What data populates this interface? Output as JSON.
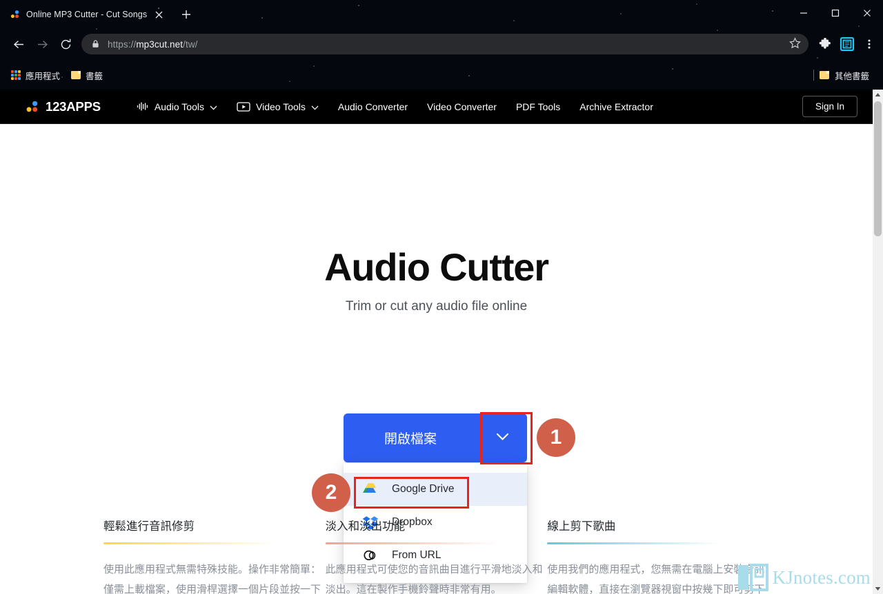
{
  "browser": {
    "tab": {
      "title": "Online MP3 Cutter - Cut Songs",
      "favicon": "123apps-dots-favicon",
      "close_icon": "close-icon",
      "newtab_icon": "plus-icon"
    },
    "window_controls": {
      "minimize": "minimize-icon",
      "maximize": "maximize-icon",
      "close": "close-icon"
    },
    "toolbar": {
      "back_icon": "arrow-left-icon",
      "forward_icon": "arrow-right-icon",
      "reload_icon": "reload-icon",
      "lock_icon": "lock-icon",
      "url_full": "https://mp3cut.net/tw/",
      "url_prefix": "https://",
      "url_host": "mp3cut.net",
      "url_path": "/tw/",
      "bookmark_star_icon": "star-icon",
      "extension_icon": "puzzle-piece-icon",
      "kjnotes_extension_icon": "kjnotes-extension-icon",
      "menu_icon": "three-dots-vertical-icon"
    },
    "bookmarks_bar": {
      "apps_label": "應用程式",
      "apps_icon": "apps-grid-icon",
      "bookmark_label": "書籤",
      "bookmark_icon": "folder-icon",
      "other_bookmarks_label": "其他書籤",
      "other_bookmarks_icon": "folder-icon"
    },
    "scrollbar": {
      "up_arrow_icon": "scroll-up-arrow-icon",
      "down_arrow_icon": "scroll-down-arrow-icon"
    }
  },
  "site": {
    "logo_text": "123APPS",
    "logo_icon": "123apps-dots-logo",
    "nav": [
      {
        "label": "Audio Tools",
        "icon": "audio-waveform-icon",
        "caret": true
      },
      {
        "label": "Video Tools",
        "icon": "video-play-box-icon",
        "caret": true
      },
      {
        "label": "Audio Converter",
        "icon": null,
        "caret": false
      },
      {
        "label": "Video Converter",
        "icon": null,
        "caret": false
      },
      {
        "label": "PDF Tools",
        "icon": null,
        "caret": false
      },
      {
        "label": "Archive Extractor",
        "icon": null,
        "caret": false
      }
    ],
    "sign_in_label": "Sign In"
  },
  "hero": {
    "title": "Audio Cutter",
    "subtitle": "Trim or cut any audio file online"
  },
  "open_button": {
    "label": "開啟檔案",
    "caret_icon": "chevron-down-icon",
    "color": "#2e5df2"
  },
  "dropdown": {
    "items": [
      {
        "label": "Google Drive",
        "icon": "google-drive-icon",
        "active": true
      },
      {
        "label": "Dropbox",
        "icon": "dropbox-icon",
        "active": false
      },
      {
        "label": "From URL",
        "icon": "link-chain-icon",
        "active": false
      }
    ]
  },
  "annotations": {
    "highlight_color": "#e8231b",
    "badge_color": "#d1604a",
    "steps": [
      {
        "number": "1",
        "target": "open-file-dropdown-caret"
      },
      {
        "number": "2",
        "target": "google-drive-menu-item"
      }
    ]
  },
  "features": [
    {
      "title": "輕鬆進行音訊修剪",
      "accent": "#ffd740",
      "body": "使用此應用程式無需特殊技能。操作非常簡單：僅需上載檔案，使用滑桿選擇一個片段並按一下"
    },
    {
      "title": "淡入和淡出功能",
      "accent": "#f0a58a",
      "body": "此應用程式可使您的音訊曲目進行平滑地淡入和淡出。這在製作手機鈴聲時非常有用。"
    },
    {
      "title": "線上剪下歌曲",
      "accent": "#62c7dd",
      "body": "使用我們的應用程式，您無需在電腦上安裝音訊編輯軟體，直接在瀏覽器視窗中按幾下即可剪下"
    }
  ],
  "watermark": {
    "text": "KJnotes.com",
    "color": "#a8dcea"
  }
}
